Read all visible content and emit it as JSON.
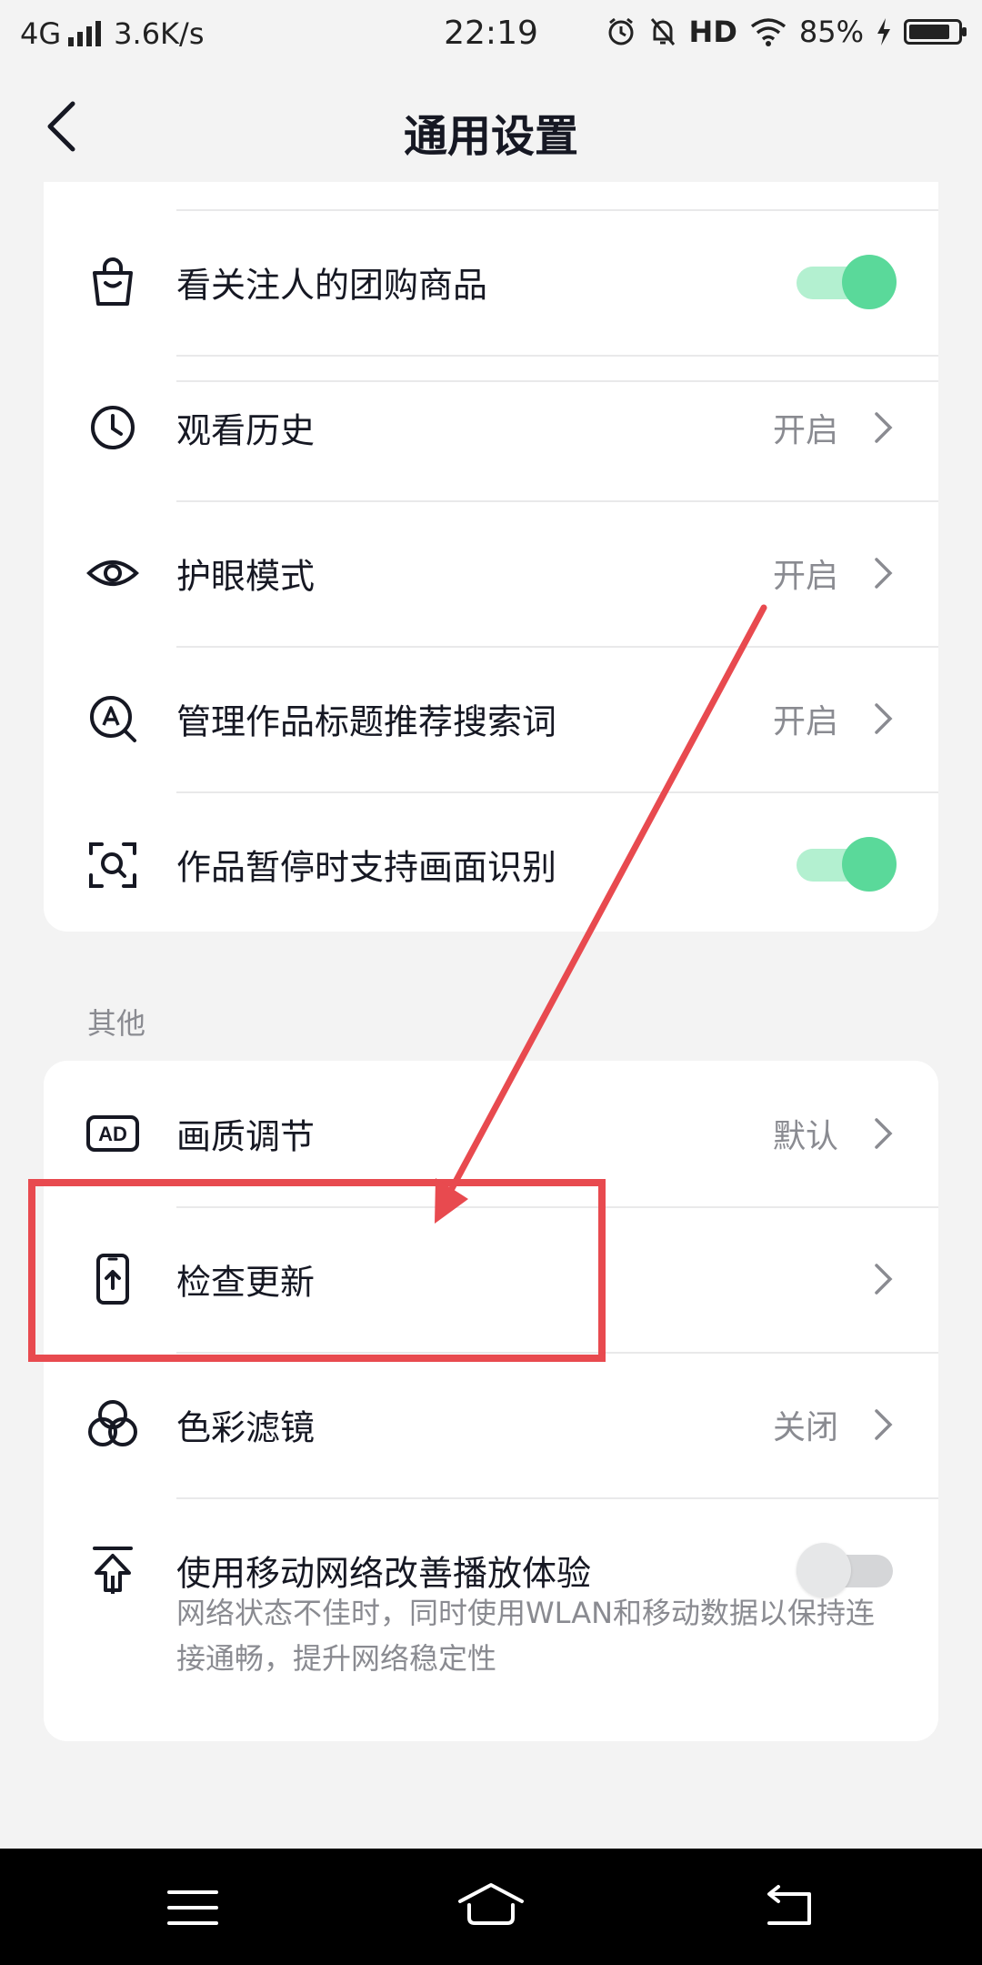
{
  "status_bar": {
    "network": "4G",
    "speed": "3.6K/s",
    "time": "22:19",
    "hd": "HD",
    "battery": "85%",
    "battery_level": 0.85
  },
  "header": {
    "title": "通用设置"
  },
  "section1": {
    "items": [
      {
        "label": "看关注人的团购商品",
        "icon": "shopping-bag-icon",
        "control": "toggle",
        "on": true
      },
      {
        "label": "观看历史",
        "icon": "clock-icon",
        "value": "开启"
      },
      {
        "label": "护眼模式",
        "icon": "eye-icon",
        "value": "开启"
      },
      {
        "label": "管理作品标题推荐搜索词",
        "icon": "search-a-icon",
        "value": "开启"
      },
      {
        "label": "作品暂停时支持画面识别",
        "icon": "scan-search-icon",
        "control": "toggle",
        "on": true
      }
    ]
  },
  "section2": {
    "title": "其他",
    "items": [
      {
        "label": "画质调节",
        "icon": "ad-quality-icon",
        "value": "默认"
      },
      {
        "label": "检查更新",
        "icon": "phone-update-icon",
        "value": ""
      },
      {
        "label": "色彩滤镜",
        "icon": "color-filter-icon",
        "value": "关闭"
      },
      {
        "label": "使用移动网络改善播放体验",
        "icon": "upload-arrow-icon",
        "control": "toggle",
        "on": false,
        "desc": "网络状态不佳时，同时使用WLAN和移动数据以保持连接通畅，提升网络稳定性"
      }
    ]
  },
  "colors": {
    "accent_toggle": "#5ad99a",
    "annotation": "#e84a4f"
  }
}
